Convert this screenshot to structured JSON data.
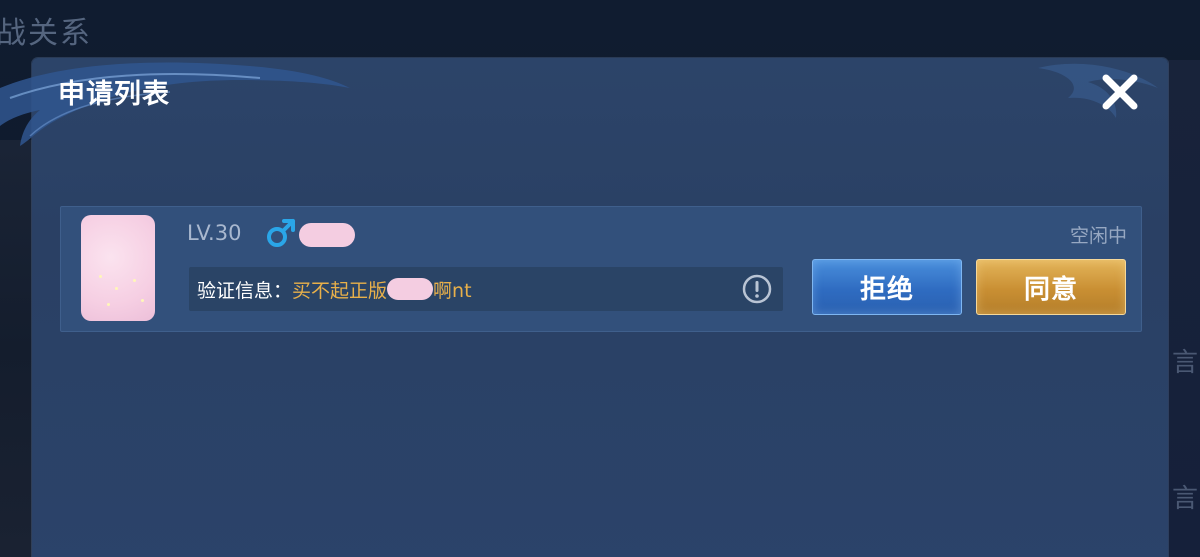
{
  "background": {
    "title": "战关系",
    "right_glyphs": [
      "言",
      "言"
    ]
  },
  "dialog": {
    "title": "申请列表",
    "close_icon": "close-icon"
  },
  "request": {
    "level": "LV.30",
    "gender_icon": "male-icon",
    "status": "空闲中",
    "verify_label": "验证信息：",
    "verify_text": "买不起正版",
    "verify_tail": "啊nt",
    "info_icon": "exclamation-circle-icon",
    "reject_label": "拒绝",
    "accept_label": "同意"
  },
  "colors": {
    "gender": "#2aa6e8",
    "verify_text": "#e8b04a",
    "reject_button": "#2f6cc1",
    "accept_button": "#c98f33"
  }
}
